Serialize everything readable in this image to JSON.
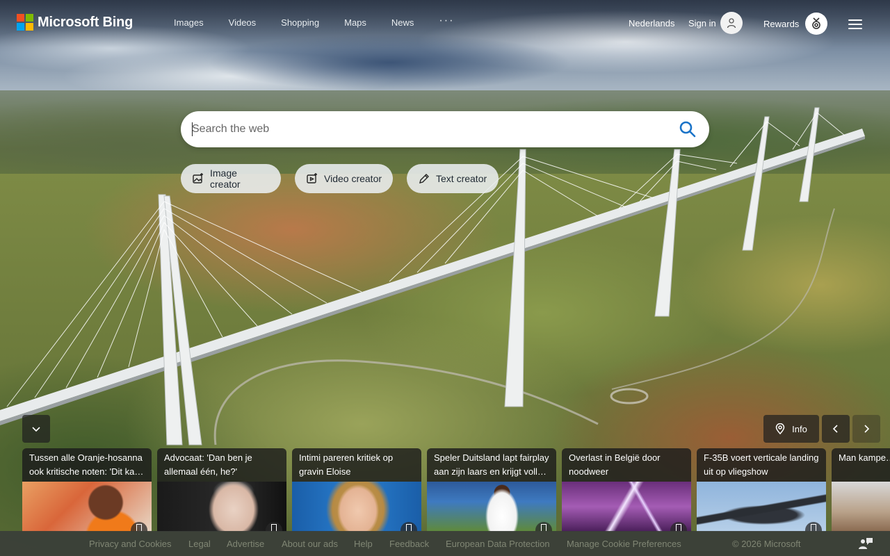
{
  "colors": {
    "ms_red": "#F25022",
    "ms_green": "#7FBA00",
    "ms_blue": "#00A4EF",
    "ms_yellow": "#FFB900",
    "search_icon": "#1A73C8"
  },
  "header": {
    "brand": "Microsoft Bing",
    "nav": [
      "Images",
      "Videos",
      "Shopping",
      "Maps",
      "News"
    ],
    "more": "···",
    "language": "Nederlands",
    "sign_in": "Sign in",
    "rewards": "Rewards"
  },
  "search": {
    "placeholder": "Search the web",
    "value": ""
  },
  "chips": [
    {
      "label": "Image creator",
      "icon": "image-creator-icon"
    },
    {
      "label": "Video creator",
      "icon": "video-creator-icon"
    },
    {
      "label": "Text creator",
      "icon": "pen-icon"
    }
  ],
  "controls": {
    "info": "Info"
  },
  "news": [
    {
      "title": "Tussen alle Oranje-hosanna ook kritische noten: 'Dit ka…"
    },
    {
      "title": "Advocaat: 'Dan ben je allemaal één, he?'"
    },
    {
      "title": "Intimi pareren kritiek op gravin Eloise"
    },
    {
      "title": "Speler Duitsland lapt fairplay aan zijn laars en krijgt voll…"
    },
    {
      "title": "Overlast in België door noodweer"
    },
    {
      "title": "F-35B voert verticale landing uit op vliegshow"
    },
    {
      "title": "Man kampe… nachts voo…"
    }
  ],
  "footer": {
    "links": [
      "Privacy and Cookies",
      "Legal",
      "Advertise",
      "About our ads",
      "Help",
      "Feedback",
      "European Data Protection",
      "Manage Cookie Preferences"
    ],
    "copyright": "© 2026 Microsoft"
  }
}
